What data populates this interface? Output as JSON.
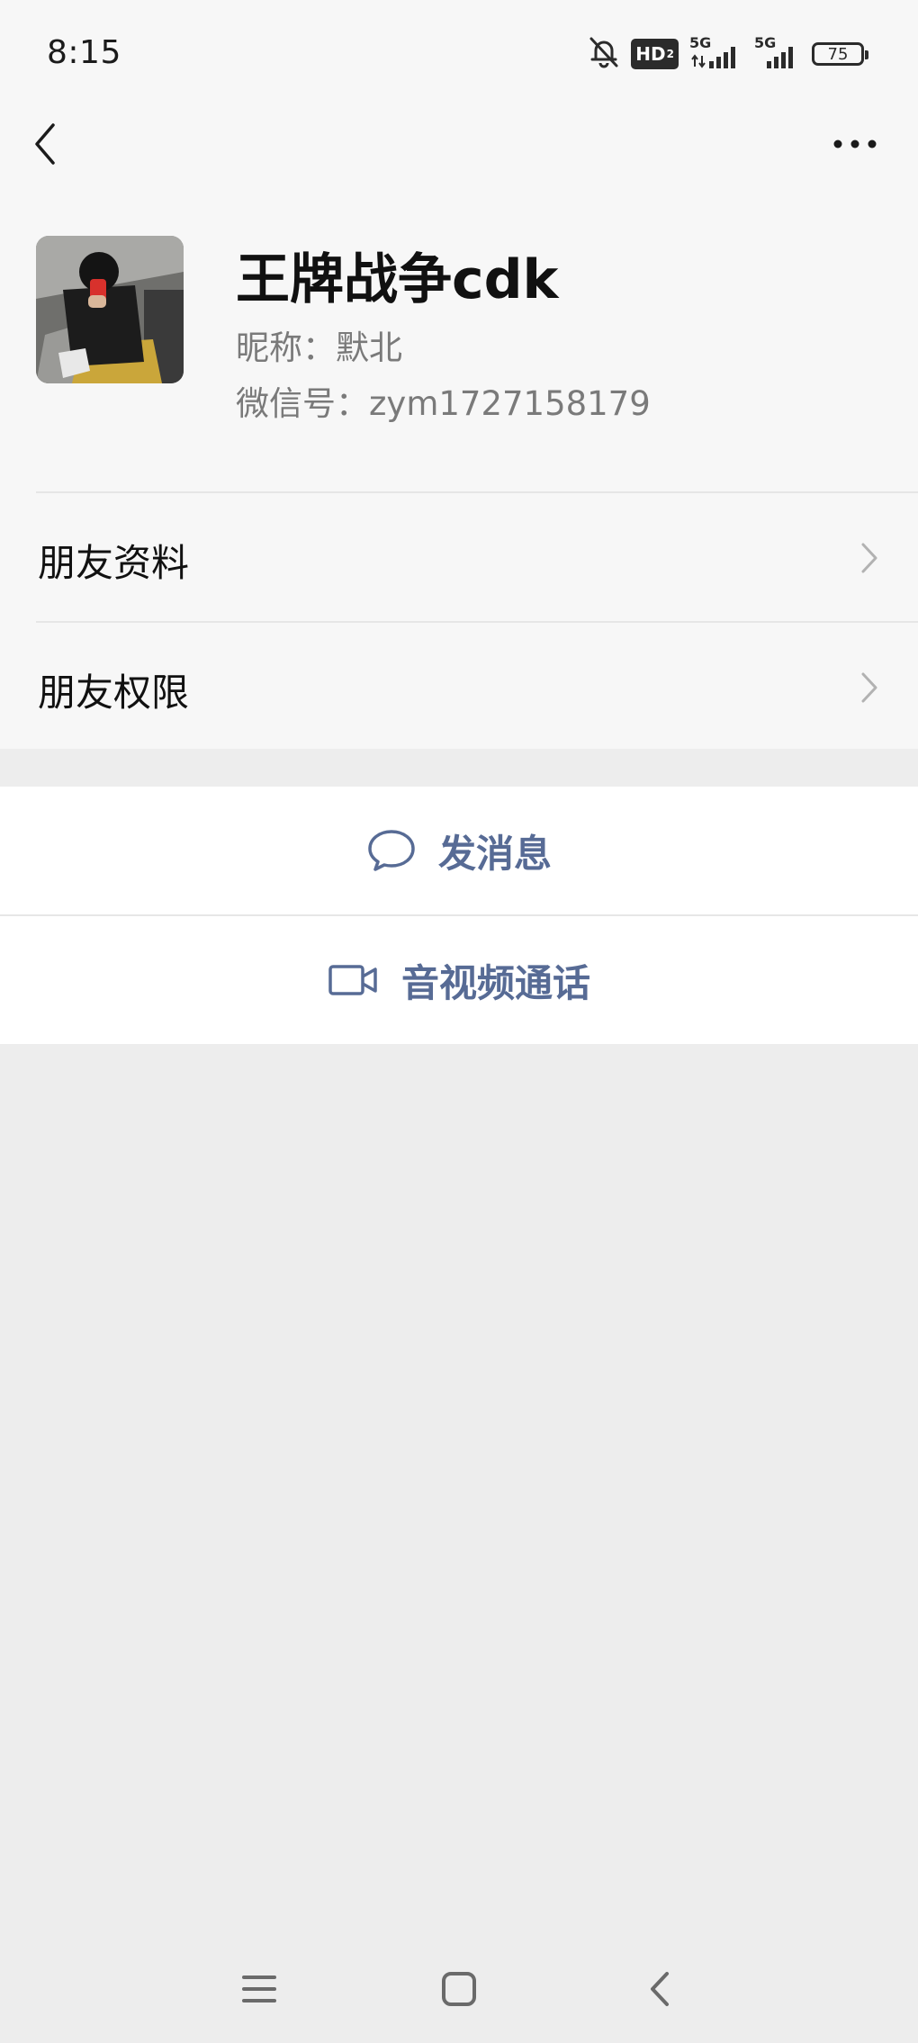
{
  "status_bar": {
    "time": "8:15",
    "hd_label": "HD",
    "hd_sub": "2",
    "network_1": "5G",
    "network_2": "5G",
    "battery": "75",
    "icons": [
      "bell-muted-icon",
      "hd-voice-icon",
      "signal-5g-icon",
      "signal-5g-icon",
      "battery-icon"
    ]
  },
  "nav": {
    "back_icon": "chevron-left-icon",
    "more_icon": "more-dots-icon"
  },
  "profile": {
    "display_name": "王牌战争cdk",
    "nickname_label": "昵称：",
    "nickname": "默北",
    "wechat_id_label": "微信号：",
    "wechat_id": "zym1727158179"
  },
  "menu": [
    {
      "label": "朋友资料"
    },
    {
      "label": "朋友权限"
    }
  ],
  "actions": {
    "message": {
      "label": "发消息",
      "icon": "chat-bubble-icon"
    },
    "call": {
      "label": "音视频通话",
      "icon": "video-camera-icon"
    }
  },
  "system_nav": {
    "icons": [
      "menu-icon",
      "home-icon",
      "back-icon"
    ]
  },
  "colors": {
    "accent": "#576b95",
    "background": "#ededed",
    "card": "#ffffff"
  }
}
